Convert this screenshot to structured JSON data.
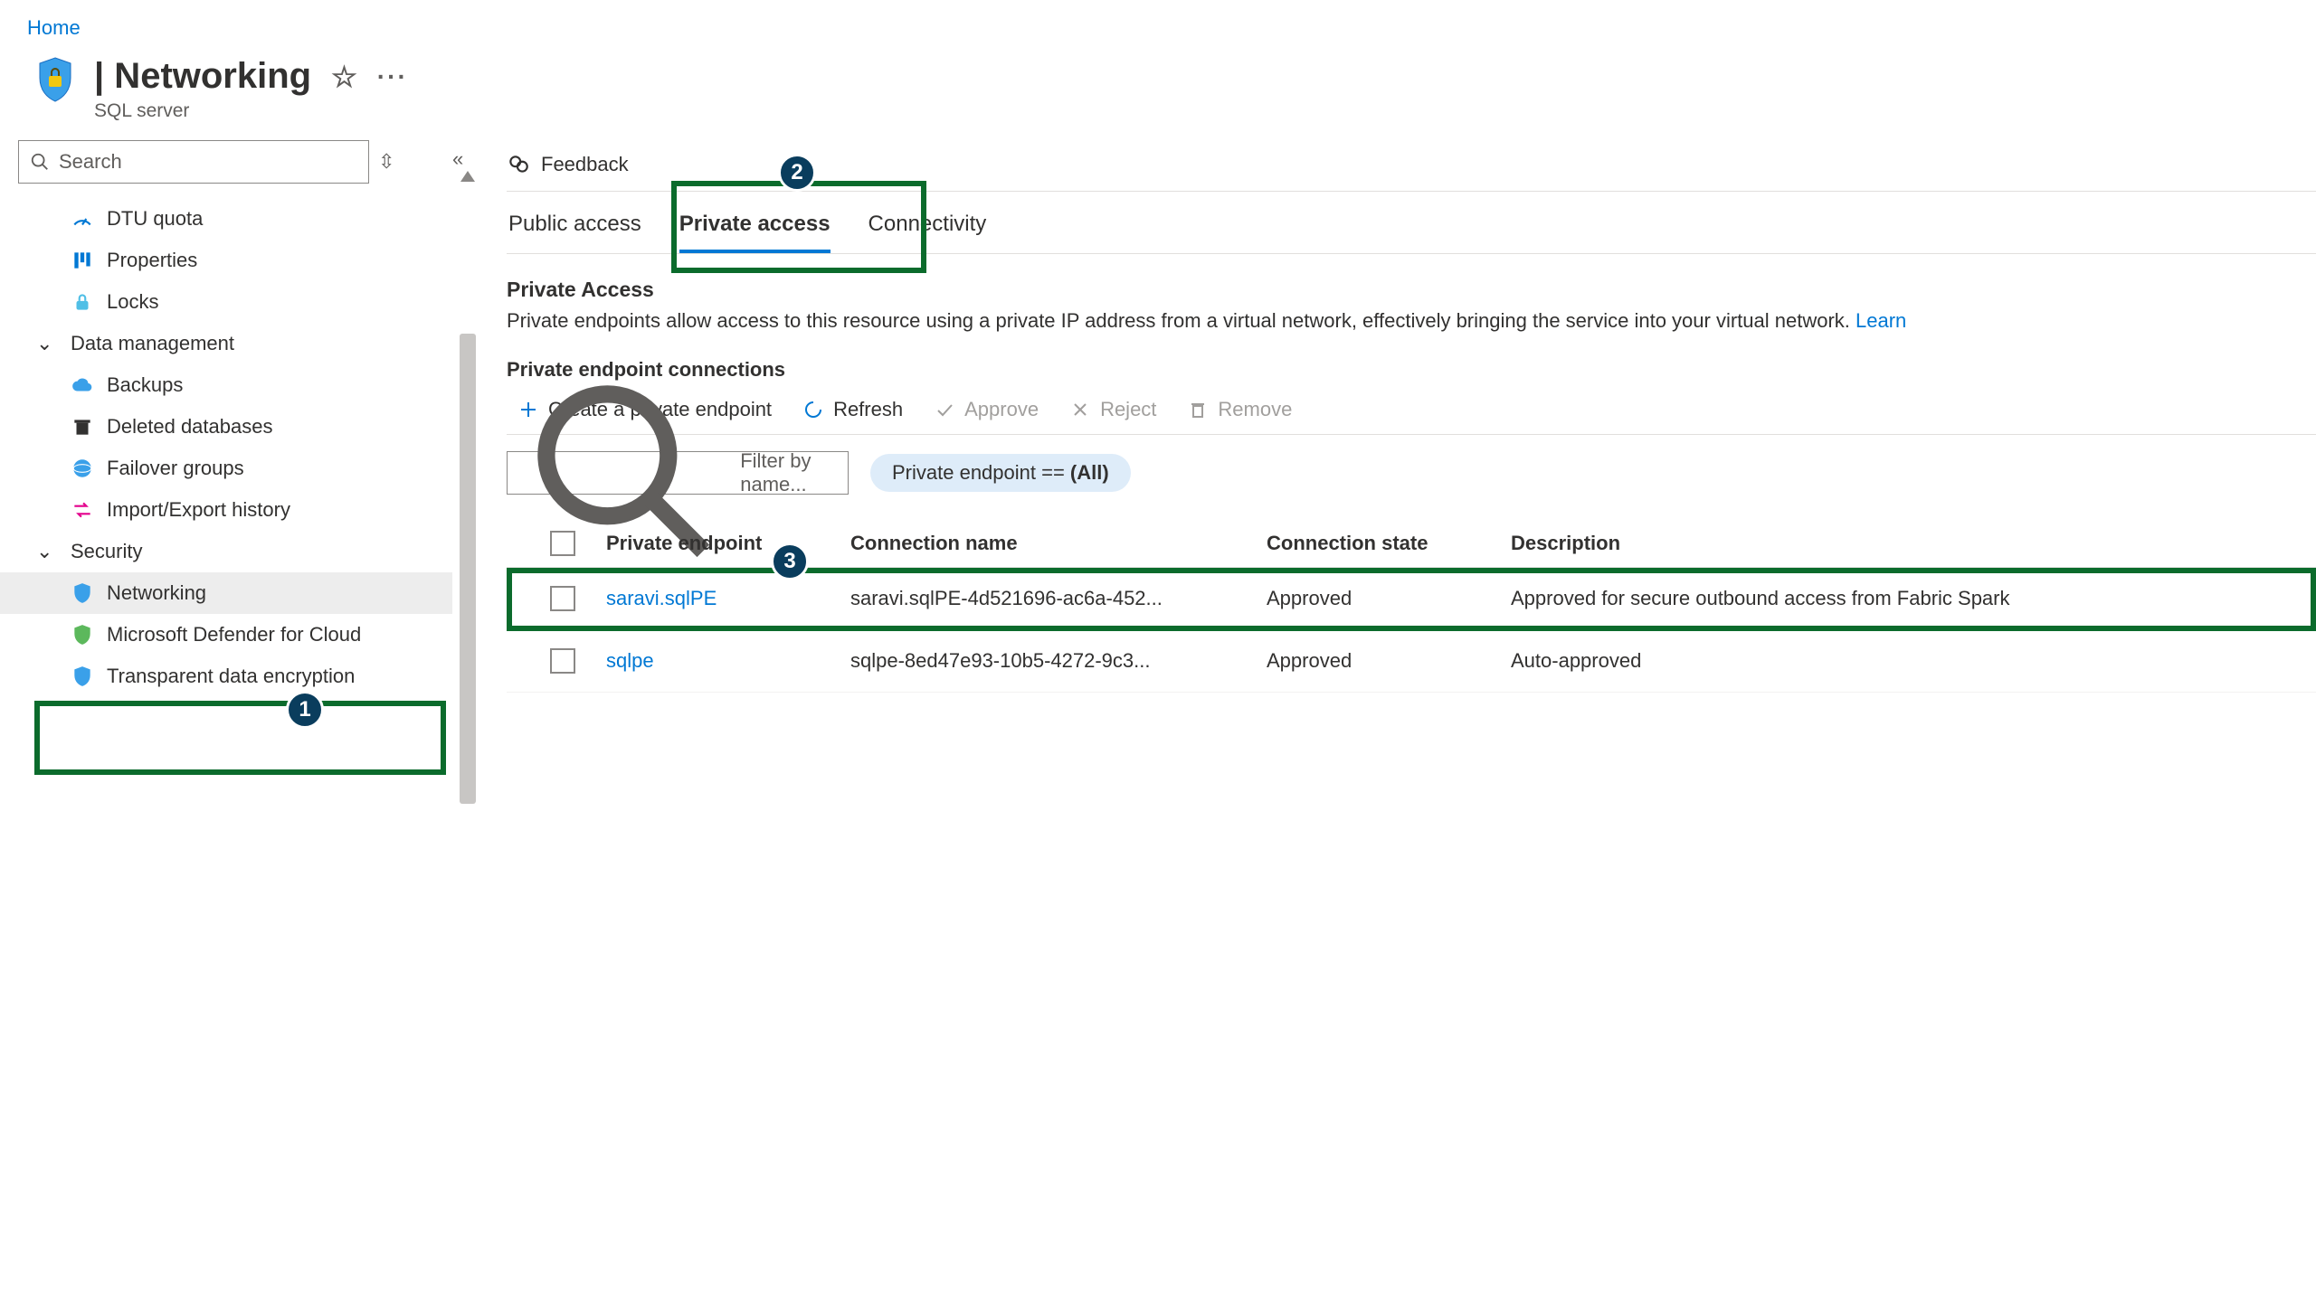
{
  "home": "Home",
  "page_title_suffix": "| Networking",
  "resource_type": "SQL server",
  "search_placeholder": "Search",
  "sidebar": {
    "items": [
      {
        "label": "DTU quota"
      },
      {
        "label": "Properties"
      },
      {
        "label": "Locks"
      }
    ],
    "group_data": "Data management",
    "data_items": [
      {
        "label": "Backups"
      },
      {
        "label": "Deleted databases"
      },
      {
        "label": "Failover groups"
      },
      {
        "label": "Import/Export history"
      }
    ],
    "group_security": "Security",
    "security_items": [
      {
        "label": "Networking"
      },
      {
        "label": "Microsoft Defender for Cloud"
      },
      {
        "label": "Transparent data encryption"
      }
    ]
  },
  "feedback": "Feedback",
  "tabs": {
    "public": "Public access",
    "private": "Private access",
    "connectivity": "Connectivity"
  },
  "section": {
    "heading": "Private Access",
    "desc_prefix": "Private endpoints allow access to this resource using a private IP address from a virtual network, effectively bringing the service into your virtual network. ",
    "learn": "Learn",
    "sub": "Private endpoint connections"
  },
  "toolbar": {
    "create": "Create a private endpoint",
    "refresh": "Refresh",
    "approve": "Approve",
    "reject": "Reject",
    "remove": "Remove"
  },
  "filter": {
    "placeholder": "Filter by name...",
    "pill_prefix": "Private endpoint == ",
    "pill_value": "(All)"
  },
  "table": {
    "cols": {
      "pe": "Private endpoint",
      "conn": "Connection name",
      "state": "Connection state",
      "desc": "Description"
    },
    "rows": [
      {
        "pe": "saravi.sqlPE",
        "conn": "saravi.sqlPE-4d521696-ac6a-452...",
        "state": "Approved",
        "desc": "Approved for secure outbound access from Fabric Spark"
      },
      {
        "pe": "sqlpe",
        "conn": "sqlpe-8ed47e93-10b5-4272-9c3...",
        "state": "Approved",
        "desc": "Auto-approved"
      }
    ]
  },
  "callouts": {
    "one": "1",
    "two": "2",
    "three": "3"
  }
}
